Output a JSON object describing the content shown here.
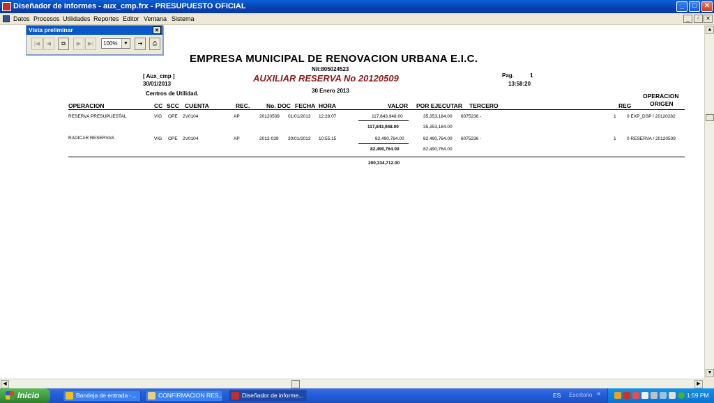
{
  "window": {
    "title": "Diseñador de informes - aux_cmp.frx - PRESUPUESTO OFICIAL",
    "buttons": {
      "minimize": "_",
      "maximize": "□",
      "close": "✕"
    }
  },
  "menu": {
    "items": [
      "Datos",
      "Procesos",
      "Utilidades",
      "Reportes",
      "Editor",
      "Ventana",
      "Sistema"
    ],
    "mdi_buttons": {
      "minimize": "_",
      "restore": "▫",
      "close": "✕"
    }
  },
  "preview_toolbar": {
    "title": "Vista preliminar",
    "close": "✕",
    "zoom": "100%",
    "dropdown": "▼"
  },
  "report": {
    "company": "EMPRESA MUNICIPAL DE RENOVACION URBANA E.I.C.",
    "nit": "Nit:805024523",
    "tag": "[ Aux_cmp ]",
    "date": "30/01/2013",
    "title": "AUXILIAR RESERVA No 20120509",
    "page_label": "Pag.",
    "page_number": "1",
    "time": "13:58:20",
    "period": "30 Enero 2013",
    "section": "Centros de Utilidad.",
    "headers": {
      "operacion": "OPERACION",
      "cc": "CC",
      "scc": "SCC",
      "cuenta": "CUENTA",
      "rec": "REC.",
      "nodoc": "No. DOC",
      "fecha": "FECHA",
      "hora": "HORA",
      "valor": "VALOR",
      "por_ejecutar": "POR EJECUTAR",
      "tercero": "TERCERO",
      "reg": "REG",
      "operacion_origen_1": "OPERACION",
      "operacion_origen_2": "ORIGEN"
    },
    "rows": [
      {
        "operacion": "RESERVA PRESUPUESTAL",
        "cc": "VIG",
        "scc": "OPE",
        "cuenta": "2V0104",
        "rec": "AP",
        "nodoc": "20120509",
        "fecha": "01/01/2013",
        "hora": "12:28:07",
        "valor": "117,843,948.00",
        "por_ejecutar": "35,353,184.00",
        "tercero": "6075236 -",
        "reg": "1",
        "origen": "0 EXP_DSP / 20120282",
        "subtotal_valor": "117,843,948.00",
        "subtotal_ejecutar": "35,353,184.00"
      },
      {
        "operacion": "RADICAR RESERVAS",
        "cc": "VIG",
        "scc": "OPE",
        "cuenta": "2V0104",
        "rec": "AP",
        "nodoc": "2013-039",
        "fecha": "30/01/2013",
        "hora": "10:55:15",
        "valor": "82,490,764.00",
        "por_ejecutar": "82,490,764.00",
        "tercero": "6075236 -",
        "reg": "1",
        "origen": "0 RESERVA / 20120509",
        "subtotal_valor": "82,490,764.00",
        "subtotal_ejecutar": "82,490,764.00"
      }
    ],
    "grand_total": "200,334,712.00"
  },
  "taskbar": {
    "start": "Inicio",
    "tasks": [
      "Bandeja de entrada -...",
      "CONFIRMACION RES...",
      "Diseñador de informe..."
    ],
    "lang": "ES",
    "desktop": "Escritorio",
    "chevron": "»",
    "clock": "1:59 PM"
  }
}
